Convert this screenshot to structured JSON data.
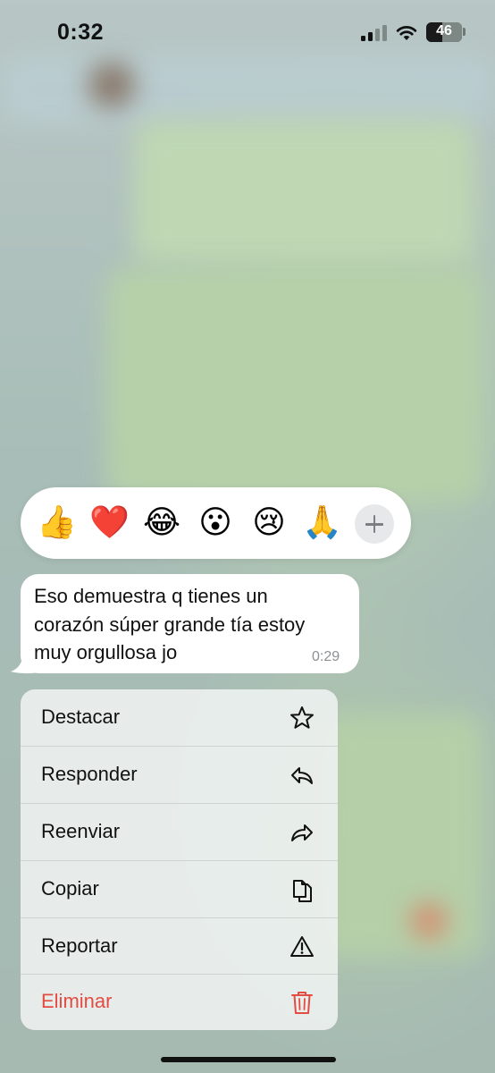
{
  "status_bar": {
    "time": "0:32",
    "battery": "46",
    "battery_level": 0.46
  },
  "reactions": [
    {
      "emoji": "👍",
      "icon": "thumbs-up"
    },
    {
      "emoji": "❤️",
      "icon": "red-heart"
    },
    {
      "emoji": "😂",
      "icon": "tears-of-joy"
    },
    {
      "emoji": "😮",
      "icon": "surprised-face"
    },
    {
      "emoji": "😢",
      "icon": "crying-face"
    },
    {
      "emoji": "🙏",
      "icon": "folded-hands"
    }
  ],
  "message": {
    "line1": "Eso demuestra q tienes un",
    "line2": "corazón súper grande tía estoy",
    "line3": "muy orgullosa jo",
    "time": "0:29"
  },
  "menu": {
    "star": "Destacar",
    "reply": "Responder",
    "forward": "Reenviar",
    "copy": "Copiar",
    "report": "Reportar",
    "delete": "Eliminar"
  },
  "colors": {
    "danger": "#e34c42",
    "bubble": "#ffffff",
    "menu_bg": "#eceff0"
  }
}
